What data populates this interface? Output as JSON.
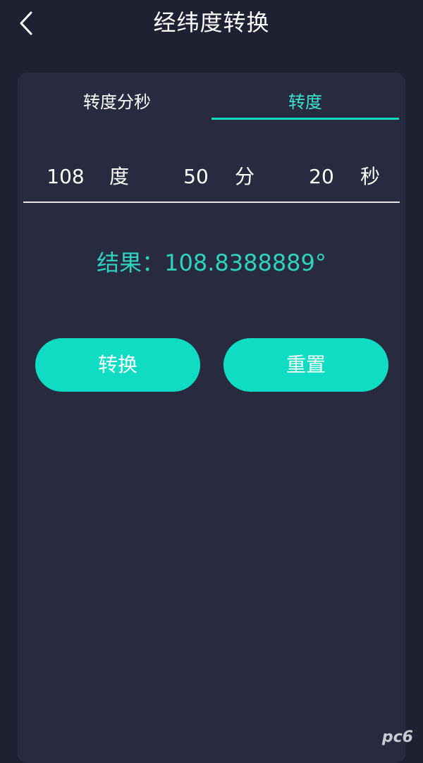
{
  "header": {
    "title": "经纬度转换",
    "back_icon": "chevron-left-icon"
  },
  "tabs": [
    {
      "label": "转度分秒",
      "active": false
    },
    {
      "label": "转度",
      "active": true
    }
  ],
  "inputs": {
    "degrees": {
      "value": "108",
      "unit": "度"
    },
    "minutes": {
      "value": "50",
      "unit": "分"
    },
    "seconds": {
      "value": "20",
      "unit": "秒"
    }
  },
  "result": {
    "label": "结果：",
    "value": "108.8388889°"
  },
  "buttons": {
    "convert": "转换",
    "reset": "重置"
  },
  "watermark": "pc6",
  "colors": {
    "background": "#1f2032",
    "card": "#282a3f",
    "accent": "#10dcc4",
    "result_text": "#2fd3bf",
    "active_tab_text": "#3ee3cf"
  }
}
